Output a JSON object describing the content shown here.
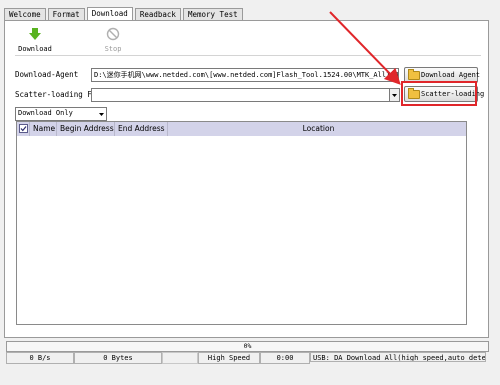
{
  "tabs": [
    {
      "label": "Welcome"
    },
    {
      "label": "Format"
    },
    {
      "label": "Download",
      "active": true
    },
    {
      "label": "Readback"
    },
    {
      "label": "Memory Test"
    }
  ],
  "toolbar": {
    "download_label": "Download",
    "stop_label": "Stop"
  },
  "download_agent": {
    "label": "Download-Agent",
    "value": "D:\\迷你手机网\\www.netded.com\\[www.netded.com]Flash_Tool.1524.00\\MTK_AllInOne_DA.bin",
    "button_label": "Download Agent"
  },
  "scatter": {
    "label": "Scatter-loading File",
    "value": "",
    "button_label": "Scatter-loading"
  },
  "mode_select": {
    "value": "Download Only"
  },
  "table": {
    "columns": [
      "Name",
      "Begin Address",
      "End Address",
      "Location"
    ],
    "rows": []
  },
  "status": {
    "progress_text": "0%",
    "progress_value": 0,
    "speed": "0 B/s",
    "bytes": "0 Bytes",
    "usb_speed": "High Speed",
    "time": "0:00",
    "message": "USB: DA Download All(high speed,auto detect)"
  },
  "colors": {
    "highlight": "#e0262a",
    "table_header": "#d3d3e9",
    "download_icon": "#59b320"
  }
}
